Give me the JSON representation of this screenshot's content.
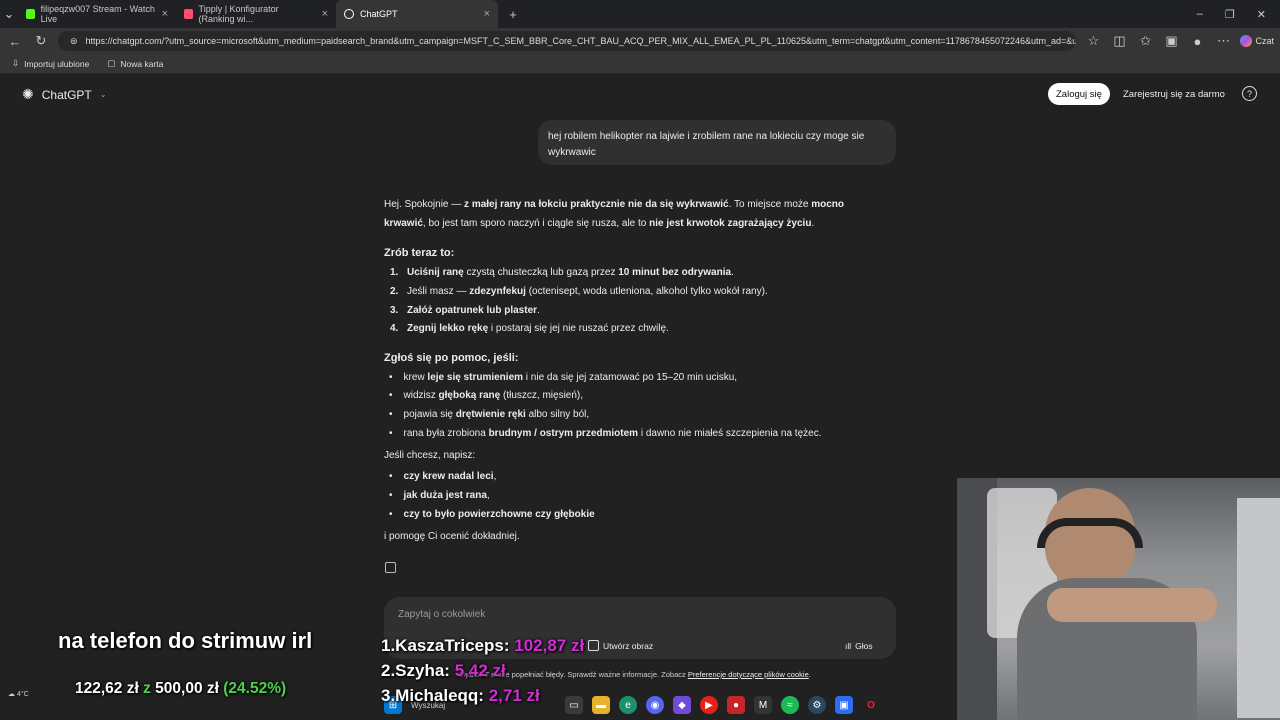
{
  "browser": {
    "tabs": [
      {
        "title": "filipeqzw007 Stream - Watch Live",
        "active": false,
        "color": "#53fc18"
      },
      {
        "title": "Tipply | Konfigurator (Ranking wi...",
        "active": false,
        "color": "#ff4f6d"
      },
      {
        "title": "ChatGPT",
        "active": true,
        "color": "#ffffff"
      }
    ],
    "url": "https://chatgpt.com/?utm_source=microsoft&utm_medium=paidsearch_brand&utm_campaign=MSFT_C_SEM_BBR_Core_CHT_BAU_ACQ_PER_MIX_ALL_EMEA_PL_PL_110625&utm_term=chatgpt&utm_content=1178678455072246&utm_ad=&utm_mat...",
    "bookmarks": [
      "Importuj ulubione",
      "Nowa karta"
    ],
    "copilot_label": "Czat"
  },
  "app": {
    "brand": "ChatGPT",
    "login_label": "Zaloguj się",
    "signup_label": "Zarejestruj się za darmo",
    "help_label": "?"
  },
  "conversation": {
    "user_message": "hej robilem helikopter na lajwie i zrobilem rane na lokieciu czy moge sie wykrwawic",
    "reply": {
      "intro_plain1": "Hej. Spokojnie — ",
      "intro_bold1": "z małej rany na łokciu praktycznie nie da się wykrwawić",
      "intro_plain2": ". To miejsce może ",
      "intro_bold2": "mocno krwawić",
      "intro_plain3": ", bo jest tam sporo naczyń i ciągle się rusza, ale to ",
      "intro_bold3": "nie jest krwotok zagrażający życiu",
      "intro_plain4": ".",
      "section1_title": "Zrób teraz to:",
      "steps": [
        {
          "n": "1.",
          "bold": "Uciśnij ranę",
          "text": " czystą chusteczką lub gazą przez ",
          "bold2": "10 minut bez odrywania",
          "tail": "."
        },
        {
          "n": "2.",
          "bold": "",
          "text": "Jeśli masz — ",
          "bold2": "zdezynfekuj",
          "tail": " (octenisept, woda utleniona, alkohol tylko wokół rany)."
        },
        {
          "n": "3.",
          "bold": "Załóż opatrunek lub plaster",
          "text": ".",
          "bold2": "",
          "tail": ""
        },
        {
          "n": "4.",
          "bold": "Zegnij lekko rękę",
          "text": " i postaraj się jej nie ruszać przez chwilę.",
          "bold2": "",
          "tail": ""
        }
      ],
      "section2_title": "Zgłoś się po pomoc, jeśli:",
      "help_items": [
        {
          "pre": "krew ",
          "bold": "leje się strumieniem",
          "post": " i nie da się jej zatamować po 15–20 min ucisku,"
        },
        {
          "pre": "widzisz ",
          "bold": "głęboką ranę",
          "post": " (tłuszcz, mięsień),"
        },
        {
          "pre": "pojawia się ",
          "bold": "drętwienie ręki",
          "post": " albo silny ból,"
        },
        {
          "pre": "rana była zrobiona ",
          "bold": "brudnym / ostrym przedmiotem",
          "post": " i dawno nie miałeś szczepienia na tężec."
        }
      ],
      "ask_intro": "Jeśli chcesz, napisz:",
      "ask_items": [
        {
          "bold": "czy krew nadal leci",
          "post": ","
        },
        {
          "bold": "jak duża jest rana",
          "post": ","
        },
        {
          "bold": "czy to było powierzchowne czy głębokie",
          "post": ""
        }
      ],
      "outro": "i pomogę Ci ocenić dokładniej."
    }
  },
  "composer": {
    "placeholder": "Zapytaj o cokolwiek",
    "image_button": "Utwórz obraz",
    "voice_button": "Głos",
    "disclaimer_prefix": "ChatGPT może popełniać błędy. Sprawdź ważne informacje. Zobacz ",
    "disclaimer_link": "Preferencje dotyczące plików cookie",
    "disclaimer_suffix": "."
  },
  "stream_overlay": {
    "caption": "na telefon do strimuw irl",
    "goal_current": "122,62 zł",
    "goal_sep": "z",
    "goal_target": "500,00 zł",
    "goal_percent": "(24.52%)",
    "ranking": [
      {
        "label": "1.KaszaTriceps:",
        "amount": "102,87 zł"
      },
      {
        "label": "2.Szyha:",
        "amount": "5,42 zł"
      },
      {
        "label": "3.Michaleqq:",
        "amount": "2,71 zł"
      }
    ],
    "weather": "4°C"
  },
  "taskbar": {
    "search_label": "Wyszukaj",
    "apps": [
      "file-explorer-icon",
      "edge-icon",
      "discord-icon",
      "app-icon",
      "youtube-icon",
      "red-app-icon",
      "gmail-icon",
      "spotify-icon",
      "steam-icon",
      "roblox-icon",
      "opera-icon"
    ]
  }
}
